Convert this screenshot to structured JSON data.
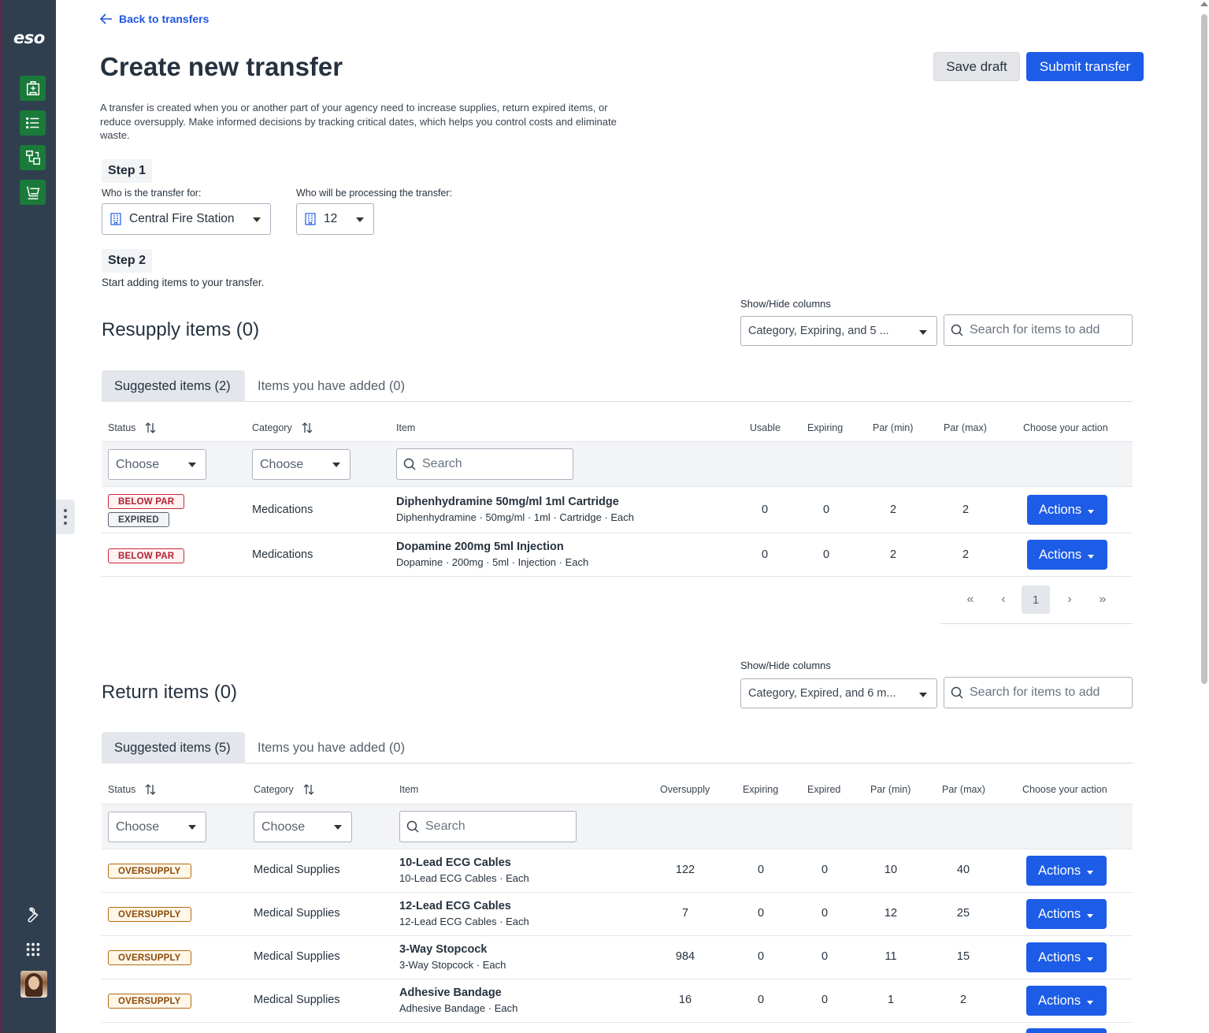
{
  "brand": "eso",
  "back_link": "Back to transfers",
  "page_title": "Create new transfer",
  "buttons": {
    "save_draft": "Save draft",
    "submit": "Submit transfer"
  },
  "intro": "A transfer is created when you or another part of your agency need to increase supplies, return expired items, or reduce oversupply. Make informed decisions by tracking critical dates, which helps you control costs and eliminate waste.",
  "step1": {
    "label": "Step 1",
    "for_label": "Who is the transfer for:",
    "for_value": "Central Fire Station",
    "processing_label": "Who will be processing the transfer:",
    "processing_value": "12"
  },
  "step2": {
    "label": "Step 2",
    "hint": "Start adding items to your transfer."
  },
  "resupply": {
    "title": "Resupply items (0)",
    "showhide_label": "Show/Hide columns",
    "showhide_value": "Category, Expiring, and 5 ...",
    "search_placeholder": "Search for items to add",
    "tabs": [
      "Suggested items (2)",
      "Items you have added (0)"
    ],
    "headers": {
      "status": "Status",
      "category": "Category",
      "item": "Item",
      "usable": "Usable",
      "expiring": "Expiring",
      "par_min": "Par (min)",
      "par_max": "Par (max)",
      "action": "Choose your action"
    },
    "filter_choose": "Choose",
    "filter_search": "Search",
    "rows": [
      {
        "badges": [
          "BELOW PAR",
          "EXPIRED"
        ],
        "category": "Medications",
        "name": "Diphenhydramine 50mg/ml 1ml Cartridge",
        "sub": "Diphenhydramine · 50mg/ml · 1ml · Cartridge · Each",
        "usable": "0",
        "expiring": "0",
        "par_min": "2",
        "par_max": "2",
        "action": "Actions"
      },
      {
        "badges": [
          "BELOW PAR"
        ],
        "category": "Medications",
        "name": "Dopamine 200mg 5ml Injection",
        "sub": "Dopamine · 200mg · 5ml · Injection · Each",
        "usable": "0",
        "expiring": "0",
        "par_min": "2",
        "par_max": "2",
        "action": "Actions"
      }
    ],
    "pager": {
      "first": "«",
      "prev": "‹",
      "current": "1",
      "next": "›",
      "last": "»"
    }
  },
  "returns": {
    "title": "Return items (0)",
    "showhide_label": "Show/Hide columns",
    "showhide_value": "Category, Expired, and 6 m...",
    "search_placeholder": "Search for items to add",
    "tabs": [
      "Suggested items (5)",
      "Items you have added (0)"
    ],
    "headers": {
      "status": "Status",
      "category": "Category",
      "item": "Item",
      "oversupply": "Oversupply",
      "expiring": "Expiring",
      "expired": "Expired",
      "par_min": "Par (min)",
      "par_max": "Par (max)",
      "action": "Choose your action"
    },
    "filter_choose": "Choose",
    "filter_search": "Search",
    "rows": [
      {
        "badge": "OVERSUPPLY",
        "category": "Medical Supplies",
        "name": "10-Lead ECG Cables",
        "sub": "10-Lead ECG Cables · Each",
        "oversupply": "122",
        "expiring": "0",
        "expired": "0",
        "par_min": "10",
        "par_max": "40",
        "action": "Actions"
      },
      {
        "badge": "OVERSUPPLY",
        "category": "Medical Supplies",
        "name": "12-Lead ECG Cables",
        "sub": "12-Lead ECG Cables · Each",
        "oversupply": "7",
        "expiring": "0",
        "expired": "0",
        "par_min": "12",
        "par_max": "25",
        "action": "Actions"
      },
      {
        "badge": "OVERSUPPLY",
        "category": "Medical Supplies",
        "name": "3-Way Stopcock",
        "sub": "3-Way Stopcock · Each",
        "oversupply": "984",
        "expiring": "0",
        "expired": "0",
        "par_min": "11",
        "par_max": "15",
        "action": "Actions"
      },
      {
        "badge": "OVERSUPPLY",
        "category": "Medical Supplies",
        "name": "Adhesive Bandage",
        "sub": "Adhesive Bandage · Each",
        "oversupply": "16",
        "expiring": "0",
        "expired": "0",
        "par_min": "1",
        "par_max": "2",
        "action": "Actions"
      }
    ]
  },
  "colors": {
    "primary": "#1d5ce6",
    "sidebar": "#2f3f4f",
    "nav_green": "#1a7a3a",
    "danger": "#c8283a",
    "warning": "#b36a12"
  },
  "icons": {
    "nav": [
      "hospital-icon",
      "list-icon",
      "transfer-icon",
      "cart-icon"
    ],
    "bottom": [
      "wrench-icon",
      "apps-grid-icon"
    ]
  }
}
